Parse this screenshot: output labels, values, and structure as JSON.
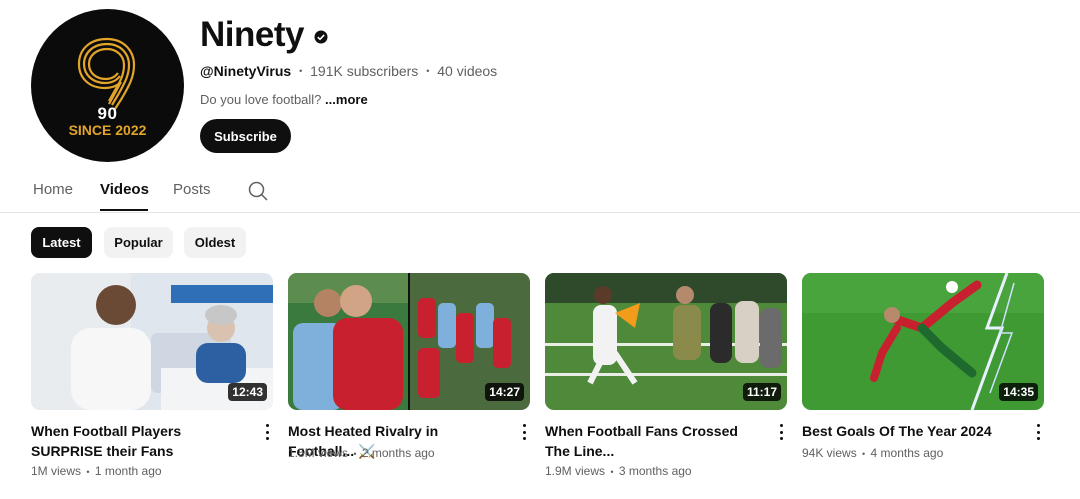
{
  "channel": {
    "name": "Ninety",
    "handle": "@NinetyVirus",
    "subscribers": "191K subscribers",
    "video_count": "40 videos",
    "description": "Do you love football?",
    "more_label": "...more",
    "subscribe_label": "Subscribe",
    "avatar": {
      "number": "90",
      "since": "SINCE 2022",
      "accent": "#e2a52a"
    }
  },
  "tabs": [
    {
      "label": "Home",
      "active": false
    },
    {
      "label": "Videos",
      "active": true
    },
    {
      "label": "Posts",
      "active": false
    }
  ],
  "filters": [
    {
      "label": "Latest",
      "active": true
    },
    {
      "label": "Popular",
      "active": false
    },
    {
      "label": "Oldest",
      "active": false
    }
  ],
  "videos": [
    {
      "title": "When Football Players SURPRISE their Fans",
      "duration": "12:43",
      "views": "1M views",
      "age": "1 month ago"
    },
    {
      "title": "Most Heated Rivalry in Football... ⚔️",
      "duration": "14:27",
      "views": "1.5M views",
      "age": "2 months ago"
    },
    {
      "title": "When Football Fans Crossed The Line...",
      "duration": "11:17",
      "views": "1.9M views",
      "age": "3 months ago"
    },
    {
      "title": "Best Goals Of The Year 2024",
      "duration": "14:35",
      "views": "94K views",
      "age": "4 months ago"
    }
  ],
  "separator": "•"
}
